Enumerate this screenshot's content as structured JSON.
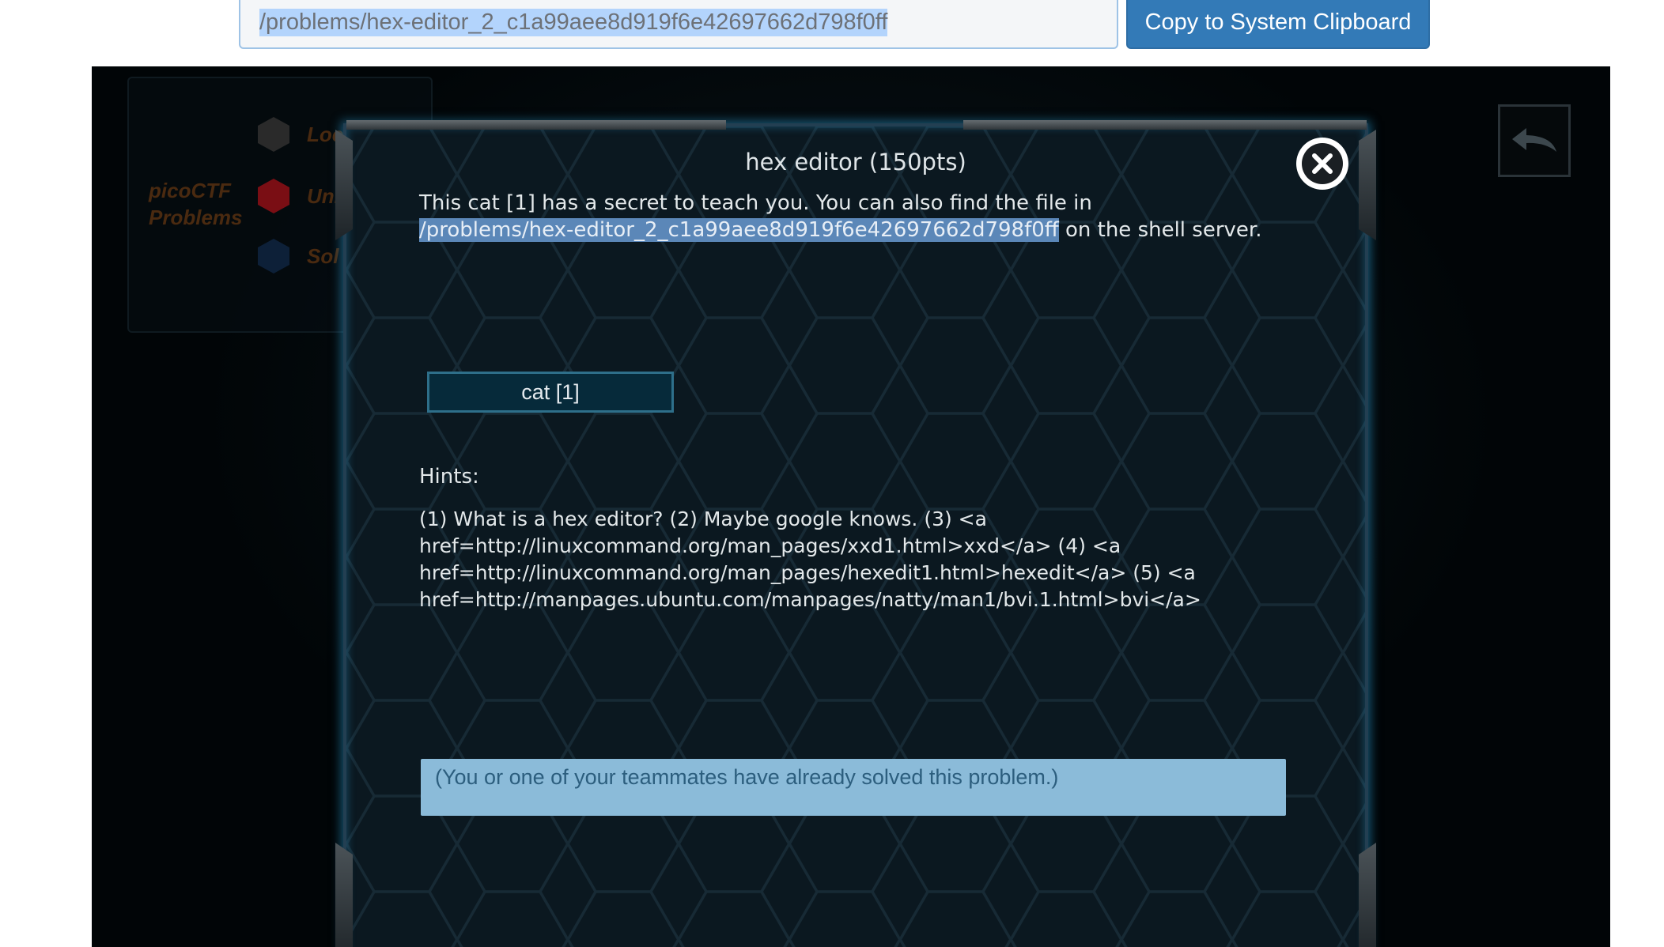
{
  "clipboard": {
    "path_value": "/problems/hex-editor_2_c1a99aee8d919f6e42697662d798f0ff",
    "copy_label": "Copy to System Clipboard"
  },
  "sidebar": {
    "title": "picoCTF Problems",
    "legend": [
      {
        "label": "Loc",
        "color": "#2a2a2a"
      },
      {
        "label": "Unl",
        "color": "#7a0e14"
      },
      {
        "label": "Sol",
        "color": "#0d2038"
      }
    ]
  },
  "back_icon": "back-arrow-icon",
  "modal": {
    "title": "hex editor (150pts)",
    "description_prefix": "This cat [1]  has a secret to teach you. You can also find the file in",
    "description_path": "/problems/hex-editor_2_c1a99aee8d919f6e42697662d798f0ff",
    "description_suffix": " on the shell server.",
    "cat_button_label": "cat [1]",
    "hints_label": "Hints:",
    "hint_lines": [
      "(1) What is a hex editor? (2) Maybe google knows. (3) <a",
      "href=http://linuxcommand.org/man_pages/xxd1.html>xxd</a> (4) <a",
      "href=http://linuxcommand.org/man_pages/hexedit1.html>hexedit</a> (5) <a",
      "href=http://manpages.ubuntu.com/manpages/natty/man1/bvi.1.html>bvi</a>"
    ],
    "solved_message": "(You or one of your teammates have already solved this problem.)"
  }
}
